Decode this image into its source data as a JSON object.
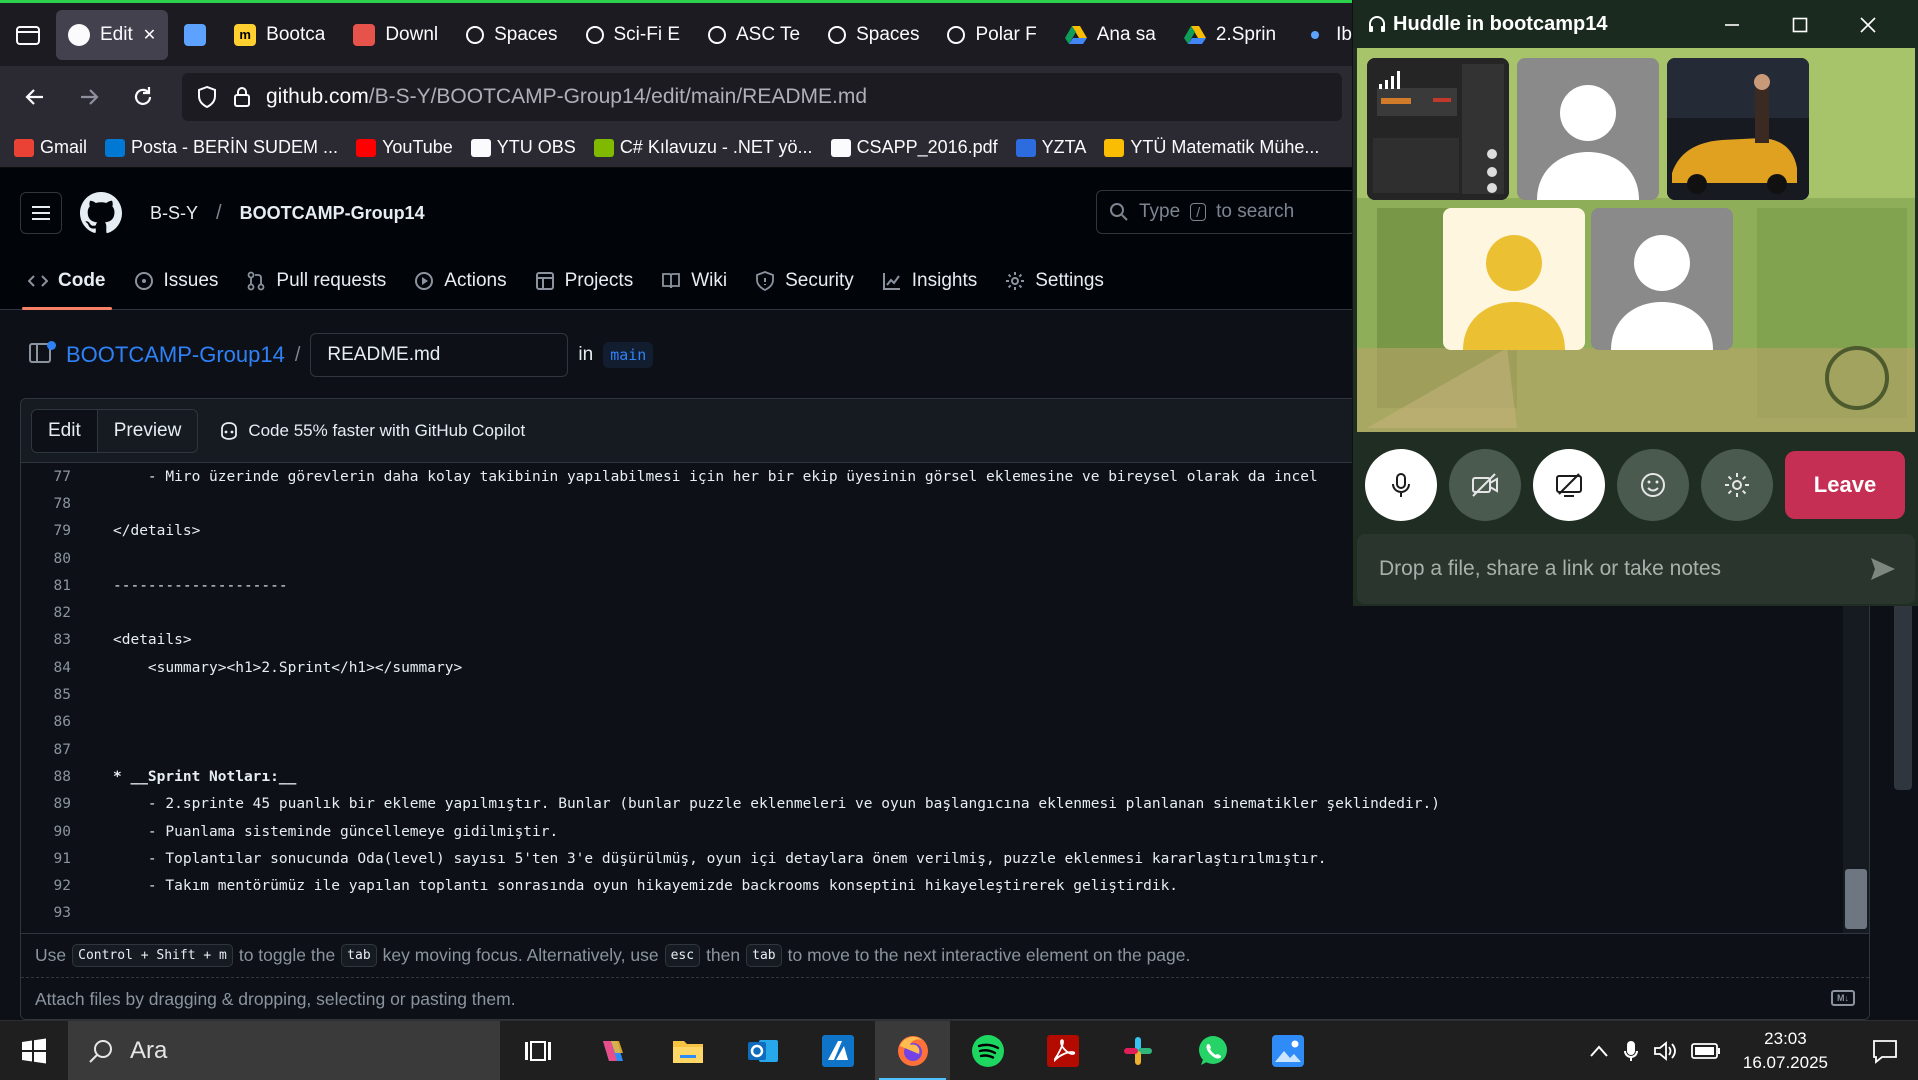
{
  "browser": {
    "tabs": [
      {
        "label": "Edit",
        "icon": "github-icon",
        "active": true
      },
      {
        "label": "",
        "icon": "blank-blue-icon",
        "active": false
      },
      {
        "label": "Bootca",
        "icon": "miro-icon",
        "active": false
      },
      {
        "label": "Downl",
        "icon": "store-icon",
        "active": false
      },
      {
        "label": "Spaces",
        "icon": "link-icon",
        "active": false
      },
      {
        "label": "Sci-Fi E",
        "icon": "link-icon",
        "active": false
      },
      {
        "label": "ASC Te",
        "icon": "link-icon",
        "active": false
      },
      {
        "label": "Spaces",
        "icon": "link-icon",
        "active": false
      },
      {
        "label": "Polar F",
        "icon": "link-icon",
        "active": false
      },
      {
        "label": "Ana sa",
        "icon": "google-drive-icon",
        "active": false
      },
      {
        "label": "2.Sprin",
        "icon": "google-drive-icon",
        "active": false
      },
      {
        "label": "Ib",
        "icon": "dot-icon",
        "active": false
      }
    ],
    "url_host": "github.com",
    "url_path": "/B-S-Y/BOOTCAMP-Group14/edit/main/README.md",
    "bookmarks": [
      {
        "label": "Gmail",
        "color": "#ea4335"
      },
      {
        "label": "Posta - BERİN SUDEM ...",
        "color": "#0078d4"
      },
      {
        "label": "YouTube",
        "color": "#ff0000"
      },
      {
        "label": "YTU OBS",
        "color": "#fbfbfe"
      },
      {
        "label": "C# Kılavuzu - .NET yö...",
        "color": "#7fba00"
      },
      {
        "label": "CSAPP_2016.pdf",
        "color": "#fbfbfe"
      },
      {
        "label": "YZTA",
        "color": "#2d6cdf"
      },
      {
        "label": "YTÜ Matematik Mühe...",
        "color": "#fbbc04"
      }
    ]
  },
  "github": {
    "owner": "B-S-Y",
    "repo": "BOOTCAMP-Group14",
    "search_prefix": "Type",
    "search_key": "/",
    "search_suffix": "to search",
    "tabs": [
      {
        "label": "Code",
        "icon": "code-icon",
        "active": true
      },
      {
        "label": "Issues",
        "icon": "issue-icon"
      },
      {
        "label": "Pull requests",
        "icon": "pull-request-icon"
      },
      {
        "label": "Actions",
        "icon": "play-icon"
      },
      {
        "label": "Projects",
        "icon": "table-icon"
      },
      {
        "label": "Wiki",
        "icon": "book-icon"
      },
      {
        "label": "Security",
        "icon": "shield-icon"
      },
      {
        "label": "Insights",
        "icon": "graph-icon"
      },
      {
        "label": "Settings",
        "icon": "gear-icon"
      }
    ],
    "editor": {
      "repo_link": "BOOTCAMP-Group14",
      "path_sep": "/",
      "filename": "README.md",
      "in_label": "in",
      "branch": "main",
      "edit_tab": "Edit",
      "preview_tab": "Preview",
      "copilot_text": "Code 55% faster with GitHub Copilot",
      "lines": [
        {
          "n": "77",
          "t": "    - Miro üzerinde görevlerin daha kolay takibinin yapılabilmesi için her bir ekip üyesinin görsel eklemesine ve bireysel olarak da incel",
          "bold": false
        },
        {
          "n": "78",
          "t": "",
          "bold": false
        },
        {
          "n": "79",
          "t": "</details>",
          "bold": false
        },
        {
          "n": "80",
          "t": "",
          "bold": false
        },
        {
          "n": "81",
          "t": "--------------------",
          "bold": false
        },
        {
          "n": "82",
          "t": "",
          "bold": false
        },
        {
          "n": "83",
          "t": "<details>",
          "bold": false
        },
        {
          "n": "84",
          "t": "    <summary><h1>2.Sprint</h1></summary>",
          "bold": false
        },
        {
          "n": "85",
          "t": "",
          "bold": false
        },
        {
          "n": "86",
          "t": "",
          "bold": false
        },
        {
          "n": "87",
          "t": "",
          "bold": false
        },
        {
          "n": "88",
          "t": "* __Sprint Notları:__",
          "bold": true
        },
        {
          "n": "89",
          "t": "    - 2.sprinte 45 puanlık bir ekleme yapılmıştır. Bunlar (bunlar puzzle eklenmeleri ve oyun başlangıcına eklenmesi planlanan sinematikler şeklindedir.)",
          "bold": false
        },
        {
          "n": "90",
          "t": "    - Puanlama sisteminde güncellemeye gidilmiştir.",
          "bold": false
        },
        {
          "n": "91",
          "t": "    - Toplantılar sonucunda Oda(level) sayısı 5'ten 3'e düşürülmüş, oyun içi detaylara önem verilmiş, puzzle eklenmesi kararlaştırılmıştır.",
          "bold": false
        },
        {
          "n": "92",
          "t": "    - Takım mentörümüz ile yapılan toplantı sonrasında oyun hikayemizde backrooms konseptini hikayeleştirerek geliştirdik.",
          "bold": false
        },
        {
          "n": "93",
          "t": "",
          "bold": false
        }
      ],
      "hint_use": "Use",
      "hint_kbd1": "Control + Shift + m",
      "hint_toggle": "to toggle the",
      "hint_kbd2": "tab",
      "hint_moving": "key moving focus. Alternatively, use",
      "hint_kbd3": "esc",
      "hint_then": "then",
      "hint_kbd4": "tab",
      "hint_end": "to move to the next interactive element on the page.",
      "attach_text": "Attach files by dragging & dropping, selecting or pasting them.",
      "md_badge": "M↓"
    }
  },
  "huddle": {
    "title": "Huddle in bootcamp14",
    "leave_label": "Leave",
    "note_placeholder": "Drop a file, share a link or take notes",
    "accent_leave": "#c62f54"
  },
  "taskbar": {
    "search_label": "Ara",
    "time": "23:03",
    "date": "16.07.2025"
  }
}
